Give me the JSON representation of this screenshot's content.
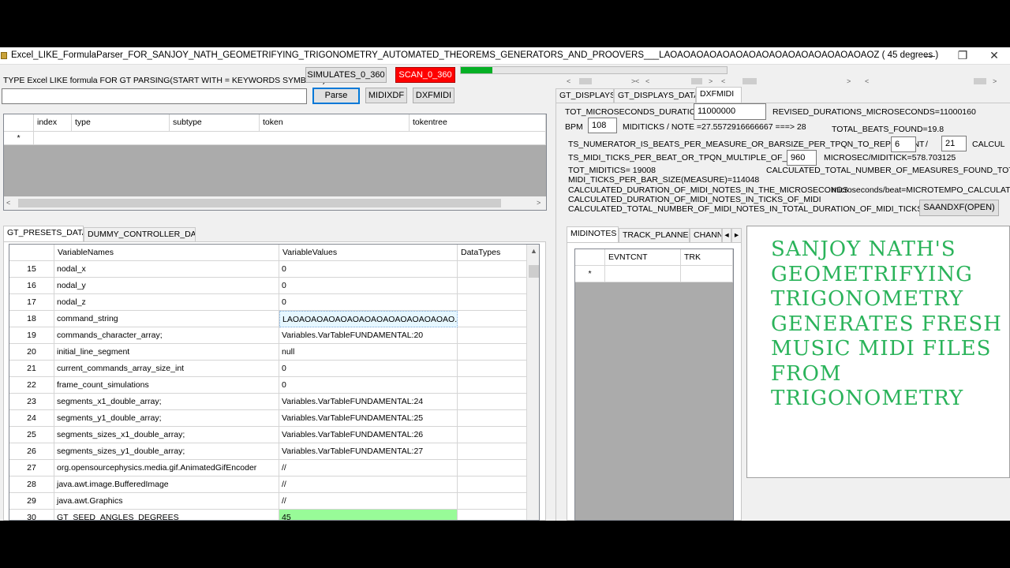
{
  "window": {
    "title": "Excel_LIKE_FormulaParser_FOR_SANJOY_NATH_GEOMETRIFYING_TRIGONOMETRY_AUTOMATED_THEOREMS_GENERATORS_AND_PROOVERS___LAOAOAOAOAOAOAOAOAOAOAOAOAOAOAOAOZ  ( 45 degrees )",
    "minimize": "—",
    "restore": "❐",
    "close": "✕"
  },
  "formula": {
    "prompt": "TYPE Excel LIKE formula FOR GT PARSING(START WITH = KEYWORDS SYMBOLS):",
    "value": "",
    "parse_label": "Parse",
    "midixdf_label": "MIDIXDF",
    "dxfmidi_label": "DXFMIDI",
    "simulates_label": "SIMULATES_0_360",
    "scan_label": "SCAN_0_360",
    "scan_color": "#ff0000",
    "progress": 0.12,
    "progress_color": "#06b025"
  },
  "token_grid": {
    "columns": [
      "index",
      "type",
      "subtype",
      "token",
      "tokentree"
    ],
    "new_row_marker": "*"
  },
  "left_tabs": [
    "GT_PRESETS_DATA",
    "DUMMY_CONTROLLER_DATA"
  ],
  "presets_grid": {
    "columns": [
      "VariableNames",
      "VariableValues",
      "DataTypes"
    ],
    "rows": [
      {
        "num": "15",
        "name": "nodal_x",
        "value": "0",
        "type": ""
      },
      {
        "num": "16",
        "name": "nodal_y",
        "value": "0",
        "type": ""
      },
      {
        "num": "17",
        "name": "nodal_z",
        "value": "0",
        "type": ""
      },
      {
        "num": "18",
        "name": "command_string",
        "value": "LAOAOAOAOAOAOAOAOAOAOAOAOAOAO...",
        "type": ""
      },
      {
        "num": "19",
        "name": "commands_character_array;",
        "value": "Variables.VarTableFUNDAMENTAL:20",
        "type": ""
      },
      {
        "num": "20",
        "name": "initial_line_segment",
        "value": "null",
        "type": ""
      },
      {
        "num": "21",
        "name": "current_commands_array_size_int",
        "value": "0",
        "type": ""
      },
      {
        "num": "22",
        "name": "frame_count_simulations",
        "value": "0",
        "type": ""
      },
      {
        "num": "23",
        "name": "segments_x1_double_array;",
        "value": "Variables.VarTableFUNDAMENTAL:24",
        "type": ""
      },
      {
        "num": "24",
        "name": "segments_y1_double_array;",
        "value": "Variables.VarTableFUNDAMENTAL:25",
        "type": ""
      },
      {
        "num": "25",
        "name": "segments_sizes_x1_double_array;",
        "value": "Variables.VarTableFUNDAMENTAL:26",
        "type": ""
      },
      {
        "num": "26",
        "name": "segments_sizes_y1_double_array;",
        "value": "Variables.VarTableFUNDAMENTAL:27",
        "type": ""
      },
      {
        "num": "27",
        "name": "org.opensourcephysics.media.gif.AnimatedGifEncoder",
        "value": "//",
        "type": ""
      },
      {
        "num": "28",
        "name": "java.awt.image.BufferedImage",
        "value": "//",
        "type": ""
      },
      {
        "num": "29",
        "name": "java.awt.Graphics",
        "value": "//",
        "type": ""
      },
      {
        "num": "30",
        "name": "GT_SEED_ANGLES_DEGREES",
        "value": "45",
        "type": ""
      }
    ]
  },
  "right_tabs": [
    "GT_DISPLAYS",
    "GT_DISPLAYS_DATA",
    "DXFMIDI"
  ],
  "dxfmidi": {
    "tot_micro_label": "TOT_MICROSECONDS_DURATION",
    "tot_micro_value": "11000000",
    "revised": "REVISED_DURATIONS_MICROSECONDS=11000160",
    "bpm_label": "BPM",
    "bpm_value": "108",
    "miditicks_note": "MIDITICKS / NOTE =27.5572916666667  ===> 28",
    "total_beats": "TOTAL_BEATS_FOUND=19.8",
    "ts_numerator_label": "TS_NUMERATOR_IS_BEATS_PER_MEASURE_OR_BARSIZE_PER_TPQN_TO_REPRESENT",
    "ts_numerator_value": "6",
    "ts_slash": "/",
    "ts_denominator_value": "21",
    "calcul_cut": "CALCUL",
    "ts_ticks_label": "TS_MIDI_TICKS_PER_BEAT_OR_TPQN_MULTIPLE_OF_480",
    "ts_ticks_value": "960",
    "microsec_miditick": "MICROSEC/MIDITICK=578.703125",
    "tot_miditics": "TOT_MIDITICS= 19008",
    "calc_total_measures": "CALCULATED_TOTAL_NUMBER_OF_MEASURES_FOUND_TOTAL_",
    "midi_ticks_per_bar": "MIDI_TICKS_PER_BAR_SIZE(MEASURE)=114048",
    "calc_duration_micro": "CALCULATED_DURATION_OF_MIDI_NOTES_IN_THE_MICROSECONDS",
    "microseconds_beat": "microseconds/beat=MICROTEMPO_CALCULATI",
    "calc_duration_ticks": "CALCULATED_DURATION_OF_MIDI_NOTES_IN_TICKS_OF_MIDI",
    "calc_total_notes": "CALCULATED_TOTAL_NUMBER_OF_MIDI_NOTES_IN_TOTAL_DURATION_OF_MIDI_TICKS",
    "saandxf_label": "SAANDXF(OPEN)"
  },
  "inner_tabs": [
    "MIDINOTES",
    "TRACK_PLANNER",
    "CHANN"
  ],
  "midinotes_grid": {
    "columns": [
      "EVNTCNT",
      "TRK"
    ],
    "new_row_marker": "*"
  },
  "art_text": [
    "SANJOY NATH'S",
    "GEOMETRIFYING",
    "TRIGONOMETRY",
    "GENERATES FRESH",
    "MUSIC MIDI FILES",
    "FROM",
    "TRIGONOMETRY"
  ],
  "art_color": "#2ab35a",
  "icons": {
    "left": "◂",
    "right": "▸",
    "lt": "<",
    "gt": ">"
  }
}
